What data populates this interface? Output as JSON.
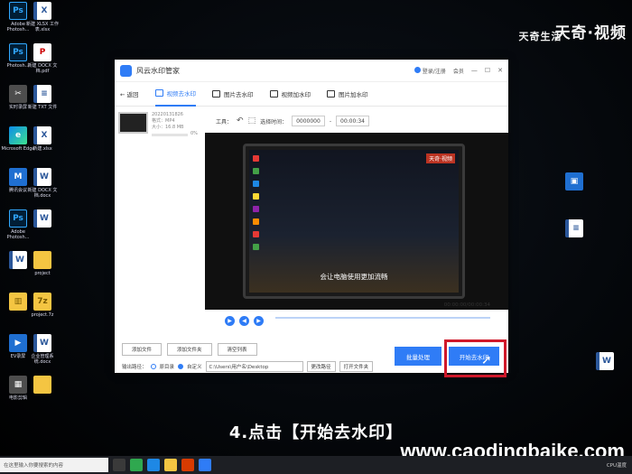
{
  "brand": {
    "main": "天奇",
    "sub": "天奇生活",
    "suffix": "视频"
  },
  "desktop_left": [
    {
      "label": "Adobe Photosh...",
      "icon": "ps-icon",
      "cls": "ps",
      "g": "Ps"
    },
    {
      "label": "Photosh...",
      "icon": "ps-icon",
      "cls": "ps",
      "g": "Ps"
    },
    {
      "label": "实时录屏",
      "icon": "capcut-icon",
      "cls": "lnk",
      "g": "✂"
    },
    {
      "label": "Microsoft Edge",
      "icon": "edge-icon",
      "cls": "edge",
      "g": "e"
    },
    {
      "label": "腾讯会议",
      "icon": "meeting-icon",
      "cls": "blue",
      "g": "M"
    },
    {
      "label": "Adobe Photosh...",
      "icon": "ps-icon",
      "cls": "ps",
      "g": "Ps"
    },
    {
      "label": "",
      "icon": "doc-icon",
      "cls": "doc",
      "g": "W"
    },
    {
      "label": "",
      "icon": "rar-icon",
      "cls": "fld",
      "g": "▥"
    },
    {
      "label": "EV录屏",
      "icon": "ev-icon",
      "cls": "blue",
      "g": "▶"
    },
    {
      "label": "电影剪辑",
      "icon": "video-icon",
      "cls": "lnk",
      "g": "▦"
    }
  ],
  "desktop_col2": [
    {
      "label": "新建 XLSX 工作表.xlsx",
      "icon": "xlsx-icon",
      "cls": "doc",
      "g": "X"
    },
    {
      "label": "新建 DOCX 文档.pdf",
      "icon": "pdf-icon",
      "cls": "pdf",
      "g": "P"
    },
    {
      "label": "新建 TXT 文件",
      "icon": "txt-icon",
      "cls": "doc",
      "g": "≡"
    },
    {
      "label": "新建.xlsx",
      "icon": "xlsx-icon",
      "cls": "doc",
      "g": "X"
    },
    {
      "label": "新建 DOCX 文档.docx",
      "icon": "doc-icon",
      "cls": "doc",
      "g": "W"
    },
    {
      "label": "",
      "icon": "doc-icon",
      "cls": "doc",
      "g": "W"
    },
    {
      "label": "project",
      "icon": "folder-icon",
      "cls": "fld",
      "g": ""
    },
    {
      "label": "project.7z",
      "icon": "archive-icon",
      "cls": "fld",
      "g": "7z"
    },
    {
      "label": "企业管理系统.docx",
      "icon": "doc-icon",
      "cls": "doc",
      "g": "W"
    },
    {
      "label": "",
      "icon": "doc-icon",
      "cls": "fld",
      "g": ""
    }
  ],
  "app": {
    "title": "风云水印管家",
    "login": "登录/注册",
    "member": "会员",
    "min": "—",
    "max": "☐",
    "close": "✕",
    "back": "返回",
    "tabs": [
      "视频去水印",
      "图片去水印",
      "视频加水印",
      "图片加水印"
    ],
    "file": {
      "name": "20220131826",
      "format": "格式：MP4",
      "size": "大小：16.8 MB",
      "pct": "0%"
    },
    "toolbar": {
      "tool_label": "工具：",
      "range_label": "选择时间：",
      "start": "0000000",
      "sep": "-",
      "end": "00:00:34"
    },
    "video_caption": "会让电脑使用更加流畅",
    "video_tag": "天奇·视频",
    "time": "00:00:00/00:00:34",
    "actions": [
      "添加文件",
      "添加文件夹",
      "清空列表"
    ],
    "output_label": "输出路径：",
    "radio1": "原目录",
    "radio2": "自定义",
    "path": "C:\\Users\\用户名\\Desktop",
    "change": "更改路径",
    "open": "打开文件夹",
    "batch": "批量处理",
    "start": "开始去水印"
  },
  "step_caption": "4.点击【开始去水印】",
  "site": "www.caodingbaike.com",
  "taskbar": {
    "search": "在这里输入你要搜索的内容",
    "tray": "CPU温度"
  }
}
